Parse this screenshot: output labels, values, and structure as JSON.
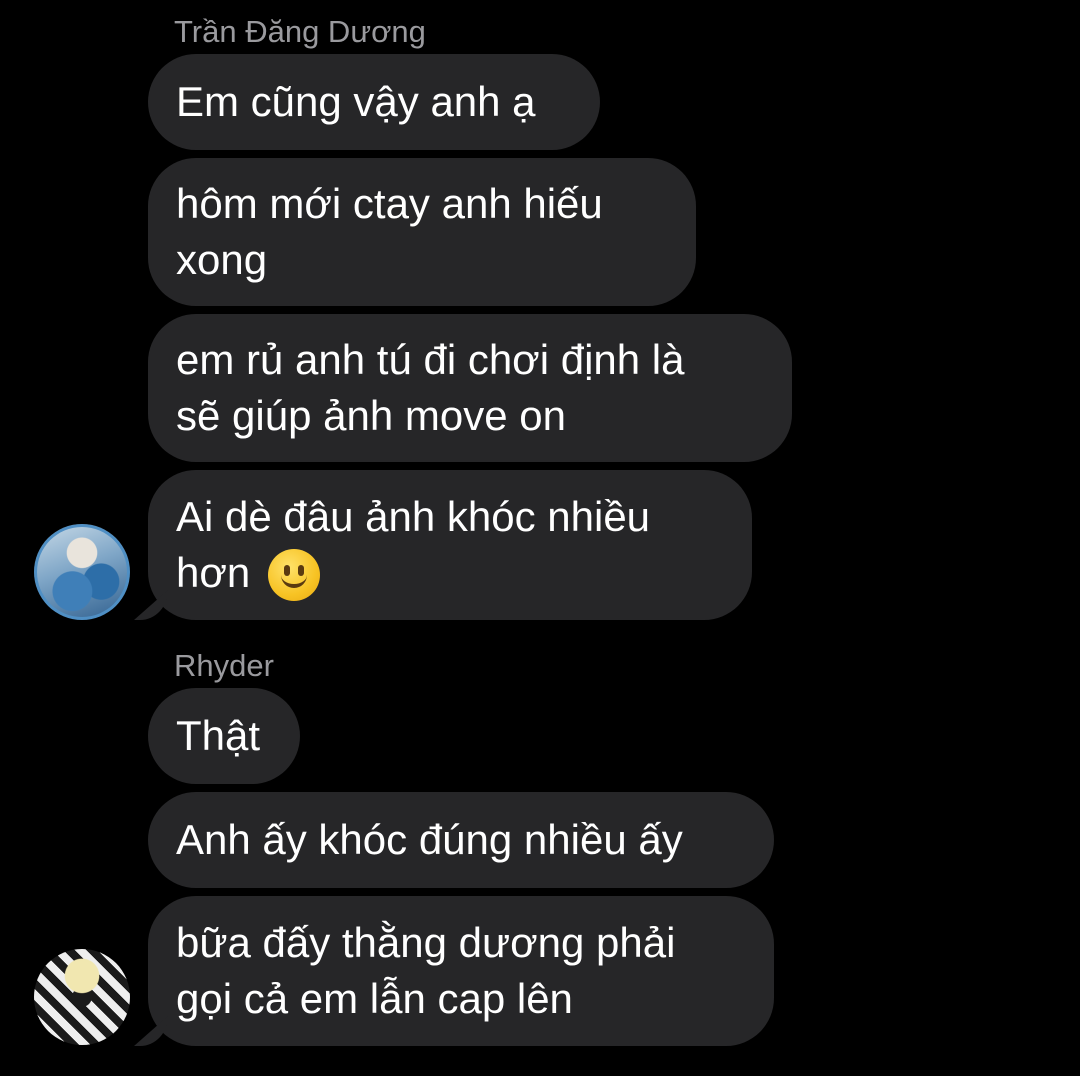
{
  "thread": {
    "groups": [
      {
        "sender": "Trần Đăng Dương",
        "messages": [
          {
            "text": "Em cũng vậy anh ạ"
          },
          {
            "text": "hôm mới ctay anh hiếu\nxong"
          },
          {
            "text": "em rủ anh tú đi chơi định là\nsẽ giúp ảnh move on"
          },
          {
            "text": "Ai dè đâu ảnh khóc nhiều\nhơn",
            "emoji": "slightly-smiling-face-icon"
          }
        ]
      },
      {
        "sender": "Rhyder",
        "messages": [
          {
            "text": "Thật"
          },
          {
            "text": "Anh ấy khóc đúng nhiều ấy"
          },
          {
            "text": "bữa đấy thằng dương phải\ngọi cả em lẫn cap lên"
          }
        ]
      }
    ]
  },
  "colors": {
    "background": "#000000",
    "bubble": "#262628",
    "sender_name": "#9a9a9e",
    "text": "#ffffff"
  }
}
